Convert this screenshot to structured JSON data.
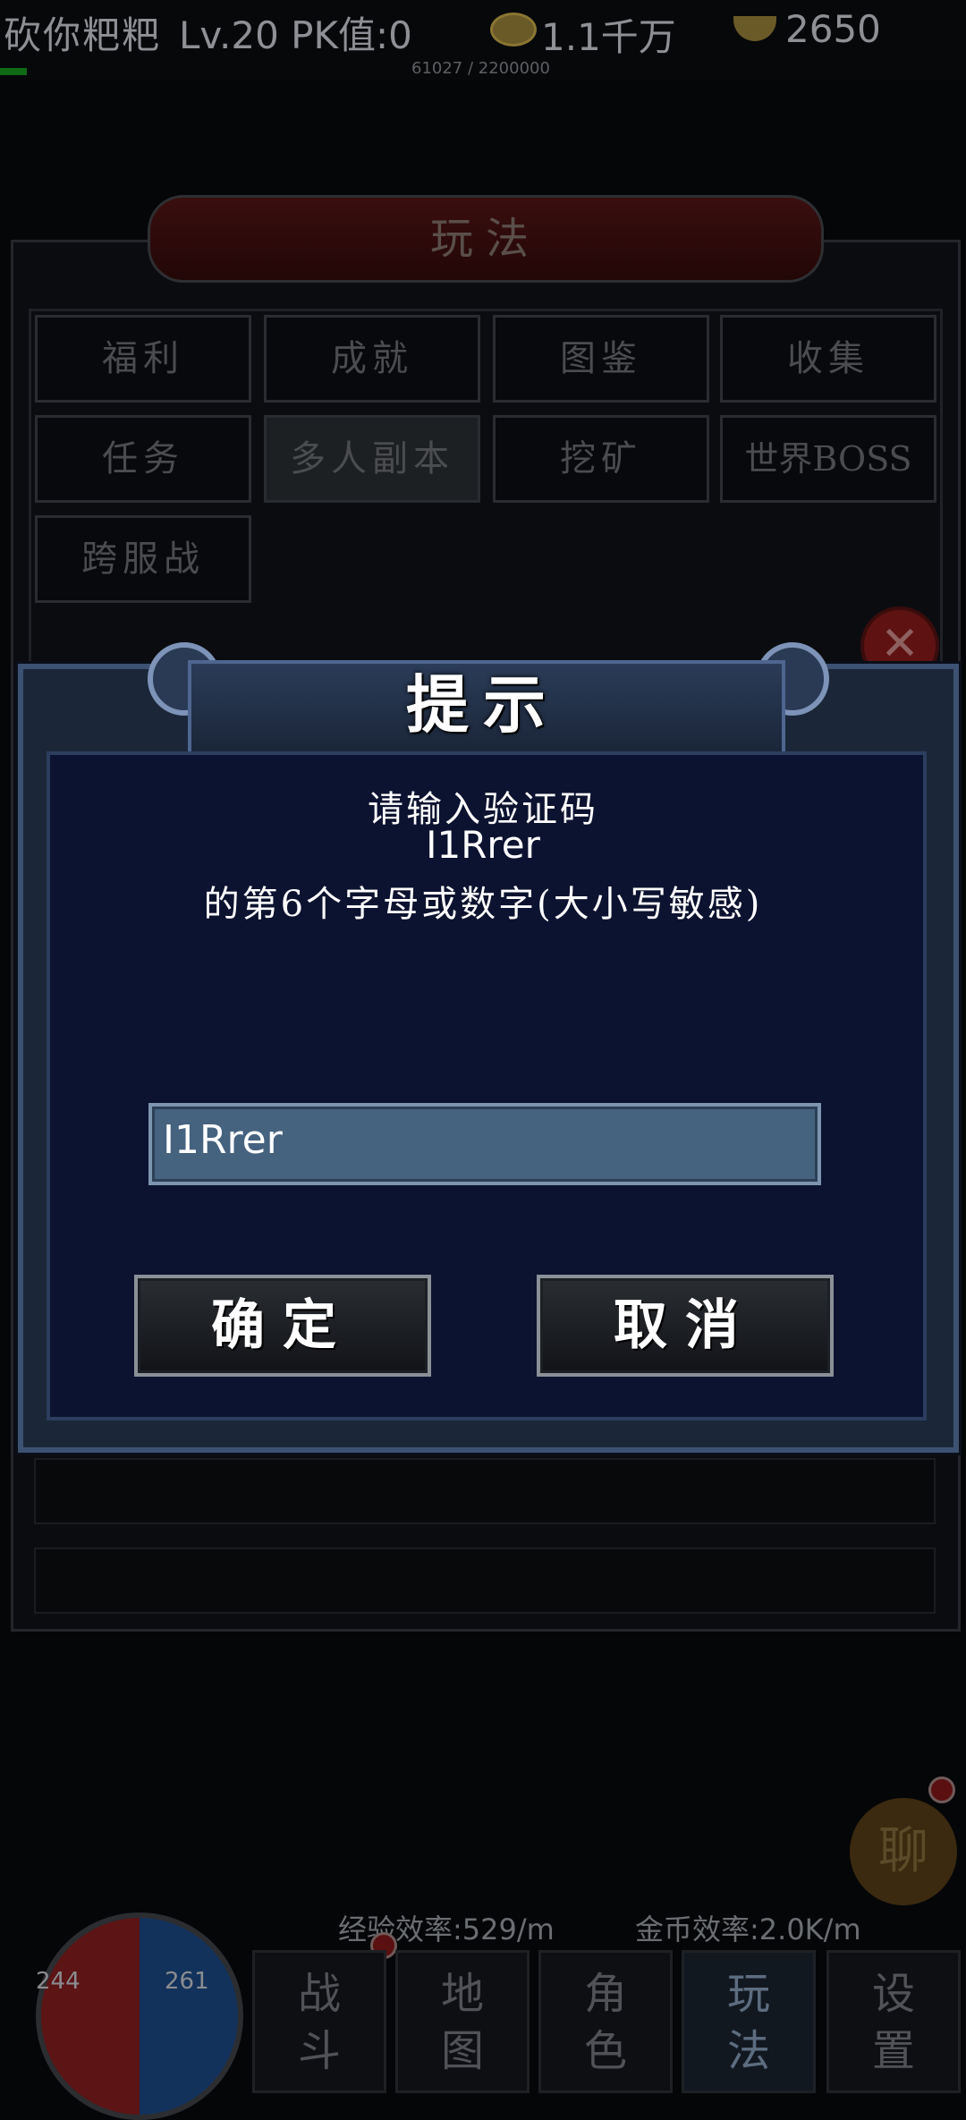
{
  "status_bar": {
    "player_name": "砍你粑粑",
    "level_pk": "Lv.20 PK值:0",
    "copper_icon": "coin-icon",
    "copper": "1.1千万",
    "gold_icon": "ingot-icon",
    "gold": "2650",
    "exp_progress": "61027 / 2200000"
  },
  "panel": {
    "title": "玩法",
    "tabs": [
      "福利",
      "成就",
      "图鉴",
      "收集",
      "任务",
      "多人副本",
      "挖矿",
      "世界BOSS",
      "跨服战"
    ],
    "active_tab": "多人副本"
  },
  "dialog": {
    "title": "提示",
    "line1": "请输入验证码",
    "line2": "I1Rrer",
    "line3": "的第6个字母或数字(大小写敏感)",
    "input_value": "I1Rrer",
    "confirm_label": "确定",
    "cancel_label": "取消"
  },
  "bottom": {
    "exp_rate": "经验效率:529/m",
    "gold_rate": "金币效率:2.0K/m",
    "hp": "244",
    "mp": "261",
    "chat_label": "聊",
    "nav": [
      {
        "label_top": "战",
        "label_bottom": "斗"
      },
      {
        "label_top": "地",
        "label_bottom": "图"
      },
      {
        "label_top": "角",
        "label_bottom": "色"
      },
      {
        "label_top": "玩",
        "label_bottom": "法"
      },
      {
        "label_top": "设",
        "label_bottom": "置"
      }
    ]
  }
}
